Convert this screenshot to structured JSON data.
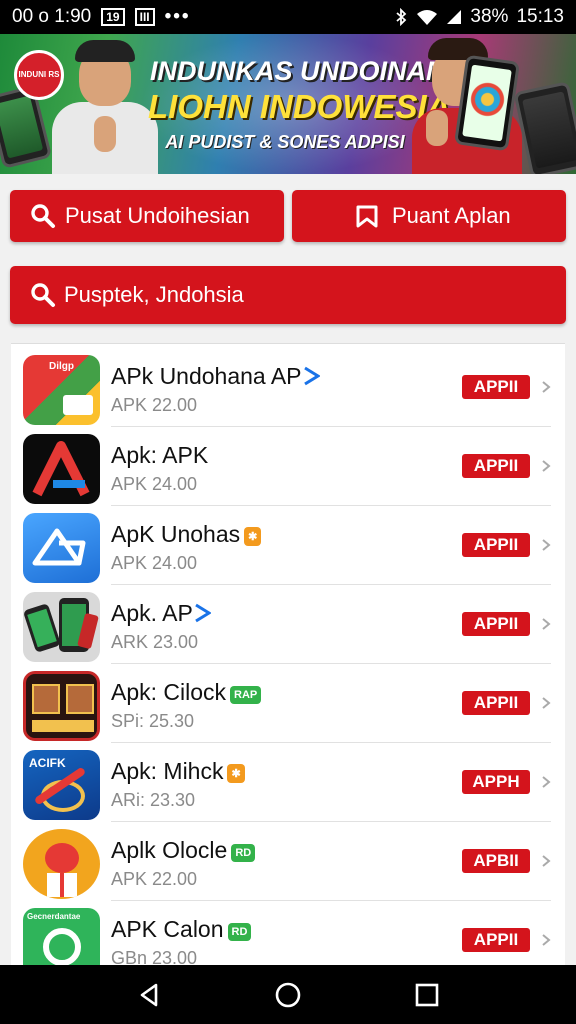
{
  "status_bar": {
    "left_text": "00 o 1:90",
    "box1": "19",
    "box2": "III",
    "dots": "•••",
    "battery": "38%",
    "time": "15:13"
  },
  "banner": {
    "logo_text": "INDUNI RS",
    "title_line1": "INDUNKAS UNDOINAN",
    "title_line2": "LIOHN INDOWESIA",
    "title_line3": "AI PUDIST & SONES ADPISI"
  },
  "buttons": {
    "primary_left": "Pusat Undoihesian",
    "primary_right": "Puant Aplan",
    "search_bar": "Pusptek, Jndohsia"
  },
  "apps": [
    {
      "name": "APk Undohana AP",
      "badge": "",
      "sub": "APK 22.00",
      "action": "APPII",
      "icon_text": "Dilgp"
    },
    {
      "name": "Apk: APK",
      "badge": "",
      "sub": "APK 24.00",
      "action": "APPII",
      "icon_text": ""
    },
    {
      "name": "ApK Unohas",
      "badge": "✱",
      "sub": "APK 24.00",
      "action": "APPII",
      "icon_text": ""
    },
    {
      "name": "Apk. AP",
      "badge": "",
      "sub": "ARK 23.00",
      "action": "APPII",
      "icon_text": ""
    },
    {
      "name": "Apk: Cilock",
      "badge": "RAP",
      "sub": "SPi: 25.30",
      "action": "APPII",
      "icon_text": ""
    },
    {
      "name": "Apk: Mihck",
      "badge": "✱",
      "sub": "ARi: 23.30",
      "action": "APPH",
      "icon_text": "ACIFK"
    },
    {
      "name": "Aplk Olocle",
      "badge": "RD",
      "sub": "APK 22.00",
      "action": "APBII",
      "icon_text": ""
    },
    {
      "name": "APK Calon",
      "badge": "RD",
      "sub": "GBn 23.00",
      "action": "APPII",
      "icon_text": "Gecnerdantae"
    }
  ],
  "colors": {
    "accent_red": "#d4141c",
    "status_bg": "#000000",
    "list_bg": "#ffffff"
  }
}
